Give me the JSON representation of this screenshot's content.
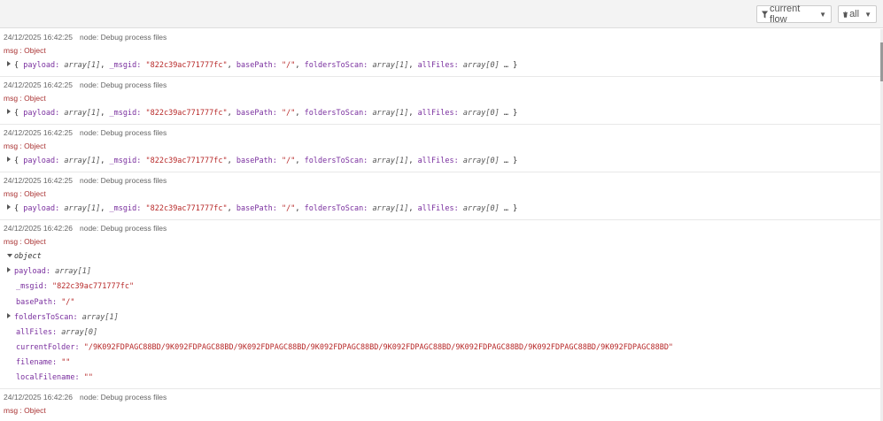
{
  "toolbar": {
    "filter_label": "current flow",
    "clear_label": "all"
  },
  "messages": [
    {
      "timestamp": "24/12/2025 16:42:25",
      "node": "node: Debug process files",
      "topic": "msg : Object",
      "summary": {
        "payload_key": "payload:",
        "payload_val": "array[1]",
        "msgid_key": "_msgid:",
        "msgid_val": "\"822c39ac771777fc\"",
        "base_key": "basePath:",
        "base_val": "\"/\"",
        "folders_key": "foldersToScan:",
        "folders_val": "array[1]",
        "all_key": "allFiles:",
        "all_val": "array[0]"
      }
    },
    {
      "timestamp": "24/12/2025 16:42:25",
      "node": "node: Debug process files",
      "topic": "msg : Object",
      "summary": {
        "payload_key": "payload:",
        "payload_val": "array[1]",
        "msgid_key": "_msgid:",
        "msgid_val": "\"822c39ac771777fc\"",
        "base_key": "basePath:",
        "base_val": "\"/\"",
        "folders_key": "foldersToScan:",
        "folders_val": "array[1]",
        "all_key": "allFiles:",
        "all_val": "array[0]"
      }
    },
    {
      "timestamp": "24/12/2025 16:42:25",
      "node": "node: Debug process files",
      "topic": "msg : Object",
      "summary": {
        "payload_key": "payload:",
        "payload_val": "array[1]",
        "msgid_key": "_msgid:",
        "msgid_val": "\"822c39ac771777fc\"",
        "base_key": "basePath:",
        "base_val": "\"/\"",
        "folders_key": "foldersToScan:",
        "folders_val": "array[1]",
        "all_key": "allFiles:",
        "all_val": "array[0]"
      }
    },
    {
      "timestamp": "24/12/2025 16:42:25",
      "node": "node: Debug process files",
      "topic": "msg : Object",
      "summary": {
        "payload_key": "payload:",
        "payload_val": "array[1]",
        "msgid_key": "_msgid:",
        "msgid_val": "\"822c39ac771777fc\"",
        "base_key": "basePath:",
        "base_val": "\"/\"",
        "folders_key": "foldersToScan:",
        "folders_val": "array[1]",
        "all_key": "allFiles:",
        "all_val": "array[0]"
      }
    }
  ],
  "expanded": {
    "timestamp": "24/12/2025 16:42:26",
    "node": "node: Debug process files",
    "topic": "msg : Object",
    "object_label": "object",
    "rows": {
      "payload_key": "payload:",
      "payload_val": "array[1]",
      "msgid_key": "_msgid:",
      "msgid_val": "\"822c39ac771777fc\"",
      "base_key": "basePath:",
      "base_val": "\"/\"",
      "folders_key": "foldersToScan:",
      "folders_val": "array[1]",
      "all_key": "allFiles:",
      "all_val": "array[0]",
      "current_key": "currentFolder:",
      "current_val": "\"/9K092FDPAGC88BD/9K092FDPAGC88BD/9K092FDPAGC88BD/9K092FDPAGC88BD/9K092FDPAGC88BD/9K092FDPAGC88BD/9K092FDPAGC88BD/9K092FDPAGC88BD\"",
      "filename_key": "filename:",
      "filename_val": "\"\"",
      "local_key": "localFilename:",
      "local_val": "\"\""
    }
  },
  "last": {
    "timestamp": "24/12/2025 16:42:26",
    "node": "node: Debug process files",
    "topic": "msg : Object"
  },
  "icons": {
    "filter": "filter-icon",
    "trash": "trash-icon",
    "caret": "caret-down-icon"
  }
}
